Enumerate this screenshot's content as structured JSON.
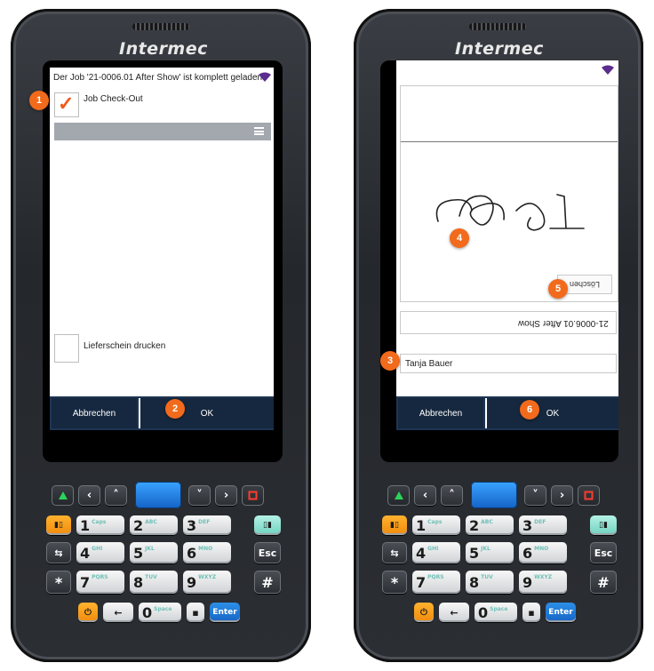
{
  "brand": "Intermec",
  "left_screen": {
    "status_message": "Der Job '21-0006.01 After Show' ist komplett geladen.",
    "checkout_checkbox": {
      "label": "Job Check-Out",
      "checked": true,
      "mark": "✓"
    },
    "delivery_checkbox": {
      "label": "Lieferschein drucken",
      "checked": false
    },
    "cancel_label": "Abbrechen",
    "ok_label": "OK",
    "badges": [
      "1",
      "2"
    ]
  },
  "right_screen": {
    "clear_label": "Löschen",
    "job_field_value": "21-0006.01 After Show",
    "name_field_value": "Tanja Bauer",
    "cancel_label": "Abbrechen",
    "ok_label": "OK",
    "badges": [
      "3",
      "4",
      "5",
      "6"
    ]
  },
  "keypad": {
    "digits": [
      {
        "d": "1",
        "sub": "Caps"
      },
      {
        "d": "2",
        "sub": "ABC"
      },
      {
        "d": "3",
        "sub": "DEF"
      },
      {
        "d": "4",
        "sub": "GHI"
      },
      {
        "d": "5",
        "sub": "JKL"
      },
      {
        "d": "6",
        "sub": "MNO"
      },
      {
        "d": "7",
        "sub": "PQRS"
      },
      {
        "d": "8",
        "sub": "TUV"
      },
      {
        "d": "9",
        "sub": "WXYZ"
      },
      {
        "d": "0",
        "sub": "Space"
      }
    ],
    "esc_label": "Esc",
    "enter_label": "Enter",
    "star_label": "*",
    "hash_label": "#",
    "back_label": "←"
  },
  "colors": {
    "accent_orange": "#f26a1b",
    "button_bar": "#16283f",
    "header_bar": "#a3a7ae"
  }
}
